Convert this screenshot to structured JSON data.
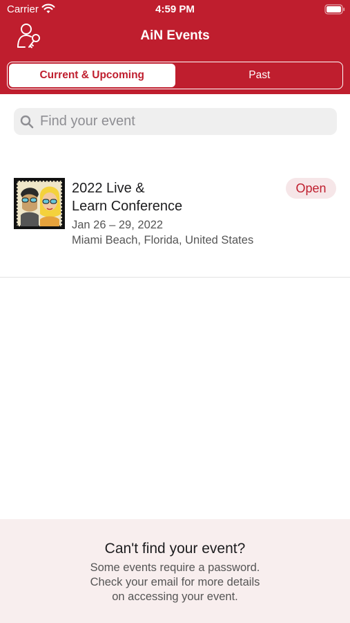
{
  "status_bar": {
    "carrier": "Carrier",
    "time": "4:59 PM",
    "icons": [
      "wifi-icon",
      "battery-icon"
    ]
  },
  "nav": {
    "title": "AiN Events",
    "left_icon": "profile-key-icon"
  },
  "segments": {
    "items": [
      {
        "label": "Current & Upcoming",
        "selected": true
      },
      {
        "label": "Past",
        "selected": false
      }
    ]
  },
  "search": {
    "placeholder": "Find your event",
    "value": "",
    "icon": "search-icon"
  },
  "events": [
    {
      "title_line1": "2022 Live &",
      "title_line2": "Learn Conference",
      "dates": "Jan 26 – 29, 2022",
      "location": "Miami Beach, Florida, United States",
      "status": "Open"
    }
  ],
  "footer": {
    "title": "Can't find your event?",
    "lines": [
      "Some events require a password.",
      "Check your email for more details",
      "on accessing your event."
    ]
  },
  "colors": {
    "brand": "#bf1e2e",
    "badge_bg": "#f6e6e8",
    "footer_bg": "#f8eeee",
    "search_bg": "#efefef"
  }
}
